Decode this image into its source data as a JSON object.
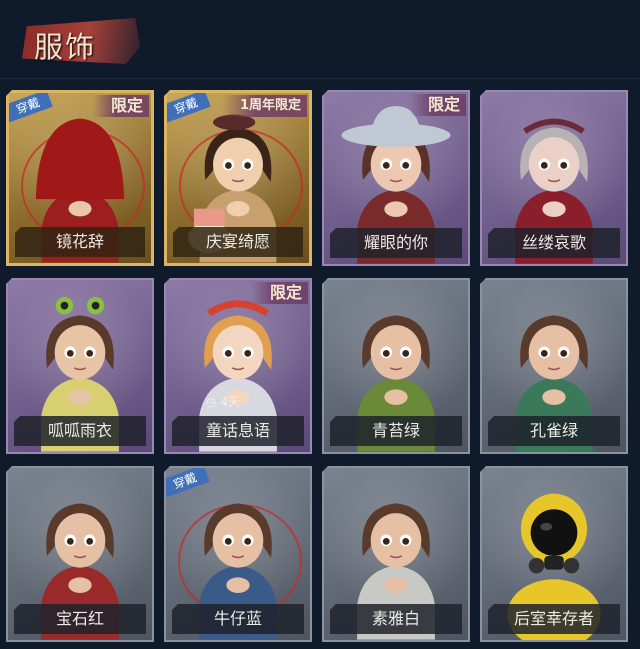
{
  "header": {
    "title": "服饰"
  },
  "badges": {
    "worn": "穿戴",
    "limited": "限定",
    "anniversary": "1周年限定"
  },
  "cards": [
    {
      "name": "镜花辞",
      "frame": "gold",
      "worn": true,
      "tag": "限定"
    },
    {
      "name": "庆宴绮愿",
      "frame": "gold",
      "worn": true,
      "tag": "1周年限定"
    },
    {
      "name": "耀眼的你",
      "frame": "purple",
      "worn": false,
      "tag": "限定"
    },
    {
      "name": "丝缕哀歌",
      "frame": "purple",
      "worn": false,
      "tag": ""
    },
    {
      "name": "呱呱雨衣",
      "frame": "purple",
      "worn": false,
      "tag": ""
    },
    {
      "name": "童话息语",
      "frame": "purple",
      "worn": false,
      "tag": "限定",
      "timer": "4天"
    },
    {
      "name": "青苔绿",
      "frame": "gray",
      "worn": false,
      "tag": ""
    },
    {
      "name": "孔雀绿",
      "frame": "gray",
      "worn": false,
      "tag": ""
    },
    {
      "name": "宝石红",
      "frame": "gray",
      "worn": false,
      "tag": ""
    },
    {
      "name": "牛仔蓝",
      "frame": "gray",
      "worn": true,
      "tag": ""
    },
    {
      "name": "素雅白",
      "frame": "gray",
      "worn": false,
      "tag": ""
    },
    {
      "name": "后室幸存者",
      "frame": "gray",
      "worn": false,
      "tag": ""
    }
  ],
  "colors": {
    "background": "#0f1a2a",
    "gold_frame": "#d9b565",
    "purple_frame": "#9c88b4",
    "gray_frame": "#8a939f",
    "worn_badge": "#3f6fb8"
  }
}
